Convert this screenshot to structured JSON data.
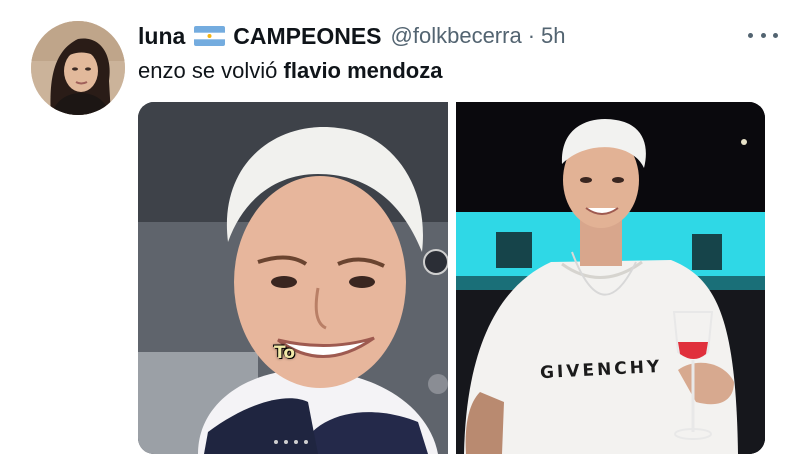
{
  "tweet": {
    "display_name": "luna",
    "name_suffix": "CAMPEONES",
    "flag_icon": "argentina-flag-icon",
    "handle": "@folkbecerra",
    "separator": "·",
    "time": "5h",
    "text_plain": "enzo se volvió ",
    "text_bold": "flavio mendoza"
  },
  "media": {
    "left_caption": "To",
    "right_shirt_text": "GIVENCHY"
  },
  "colors": {
    "secondary_text": "#536471",
    "primary_text": "#0f1419",
    "pool_cyan": "#2fd8e6"
  }
}
